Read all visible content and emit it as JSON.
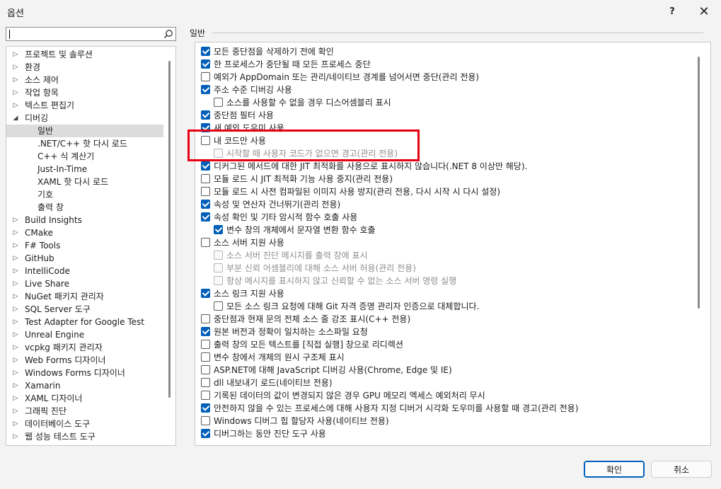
{
  "window": {
    "title": "옵션",
    "help_label": "?",
    "close_label": "✕"
  },
  "search": {
    "value": ""
  },
  "tree": [
    {
      "label": "프로젝트 및 솔루션",
      "indent": 0,
      "expander": "collapsed"
    },
    {
      "label": "환경",
      "indent": 0,
      "expander": "collapsed"
    },
    {
      "label": "소스 제어",
      "indent": 0,
      "expander": "collapsed"
    },
    {
      "label": "작업 항목",
      "indent": 0,
      "expander": "collapsed"
    },
    {
      "label": "텍스트 편집기",
      "indent": 0,
      "expander": "collapsed"
    },
    {
      "label": "디버깅",
      "indent": 0,
      "expander": "expanded"
    },
    {
      "label": "일반",
      "indent": 1,
      "expander": "none",
      "selected": true
    },
    {
      "label": ".NET/C++ 핫 다시 로드",
      "indent": 1,
      "expander": "none"
    },
    {
      "label": "C++ 식 계산기",
      "indent": 1,
      "expander": "none"
    },
    {
      "label": "Just-In-Time",
      "indent": 1,
      "expander": "none"
    },
    {
      "label": "XAML 핫 다시 로드",
      "indent": 1,
      "expander": "none"
    },
    {
      "label": "기호",
      "indent": 1,
      "expander": "none"
    },
    {
      "label": "출력 창",
      "indent": 1,
      "expander": "none"
    },
    {
      "label": "Build Insights",
      "indent": 0,
      "expander": "collapsed"
    },
    {
      "label": "CMake",
      "indent": 0,
      "expander": "collapsed"
    },
    {
      "label": "F# Tools",
      "indent": 0,
      "expander": "collapsed"
    },
    {
      "label": "GitHub",
      "indent": 0,
      "expander": "collapsed"
    },
    {
      "label": "IntelliCode",
      "indent": 0,
      "expander": "collapsed"
    },
    {
      "label": "Live Share",
      "indent": 0,
      "expander": "collapsed"
    },
    {
      "label": "NuGet 패키지 관리자",
      "indent": 0,
      "expander": "collapsed"
    },
    {
      "label": "SQL Server 도구",
      "indent": 0,
      "expander": "collapsed"
    },
    {
      "label": "Test Adapter for Google Test",
      "indent": 0,
      "expander": "collapsed"
    },
    {
      "label": "Unreal Engine",
      "indent": 0,
      "expander": "collapsed"
    },
    {
      "label": "vcpkg 패키지 관리자",
      "indent": 0,
      "expander": "collapsed"
    },
    {
      "label": "Web Forms 디자이너",
      "indent": 0,
      "expander": "collapsed"
    },
    {
      "label": "Windows Forms 디자이너",
      "indent": 0,
      "expander": "collapsed"
    },
    {
      "label": "Xamarin",
      "indent": 0,
      "expander": "collapsed"
    },
    {
      "label": "XAML 디자이너",
      "indent": 0,
      "expander": "collapsed"
    },
    {
      "label": "그래픽 진단",
      "indent": 0,
      "expander": "collapsed"
    },
    {
      "label": "데이터베이스 도구",
      "indent": 0,
      "expander": "collapsed"
    },
    {
      "label": "웹 성능 테스트 도구",
      "indent": 0,
      "expander": "collapsed"
    }
  ],
  "section_title": "일반",
  "options": [
    {
      "label": "모든 중단점을 삭제하기 전에 확인",
      "checked": true,
      "indent": 0,
      "disabled": false
    },
    {
      "label": "한 프로세스가 중단될 때 모든 프로세스 중단",
      "checked": true,
      "indent": 0,
      "disabled": false
    },
    {
      "label": "예외가 AppDomain 또는 관리/네이티브 경계를 넘어서면 중단(관리 전용)",
      "checked": false,
      "indent": 0,
      "disabled": false
    },
    {
      "label": "주소 수준 디버깅 사용",
      "checked": true,
      "indent": 0,
      "disabled": false
    },
    {
      "label": "소스를 사용할 수 없을 경우 디스어셈블리 표시",
      "checked": false,
      "indent": 1,
      "disabled": false
    },
    {
      "label": "중단점 필터 사용",
      "checked": true,
      "indent": 0,
      "disabled": false
    },
    {
      "label": "새 예외 도우미 사용",
      "checked": true,
      "indent": 0,
      "disabled": false
    },
    {
      "label": "내 코드만 사용",
      "checked": false,
      "indent": 0,
      "disabled": false
    },
    {
      "label": "시작할 때 사용자 코드가 없으면 경고(관리 전용)",
      "checked": false,
      "indent": 1,
      "disabled": true
    },
    {
      "label": "디커그된 메서드에 대한 JIT 최적화를 사용으로 표시하지 않습니다(.NET 8 이상만 해당).",
      "checked": true,
      "indent": 0,
      "disabled": false
    },
    {
      "label": "모듈 로드 시 JIT 최적화 기능 사용 중지(관리 전용)",
      "checked": false,
      "indent": 0,
      "disabled": false
    },
    {
      "label": "모듈 로드 시 사전 컴파일된 이미지 사용 방지(관리 전용, 다시 시작 시 다시 설정)",
      "checked": false,
      "indent": 0,
      "disabled": false
    },
    {
      "label": "속성 및 연산자 건너뛰기(관리 전용)",
      "checked": true,
      "indent": 0,
      "disabled": false
    },
    {
      "label": "속성 확인 및 기타 암시적 함수 호출 사용",
      "checked": true,
      "indent": 0,
      "disabled": false
    },
    {
      "label": "변수 창의 개체에서 문자열 변환 함수 호출",
      "checked": true,
      "indent": 1,
      "disabled": false
    },
    {
      "label": "소스 서버 지원 사용",
      "checked": false,
      "indent": 0,
      "disabled": false
    },
    {
      "label": "소스 서버 진단 메시지를 출력 창에 표시",
      "checked": false,
      "indent": 1,
      "disabled": true
    },
    {
      "label": "부분 신뢰 어셈블리에 대해 소스 서버 허용(관리 전용)",
      "checked": false,
      "indent": 1,
      "disabled": true
    },
    {
      "label": "항상 메시지를 표시하지 않고 신뢰할 수 없는 소스 서버 명령 실행",
      "checked": false,
      "indent": 1,
      "disabled": true
    },
    {
      "label": "소스 링크 지원 사용",
      "checked": true,
      "indent": 0,
      "disabled": false
    },
    {
      "label": "모든 소스 링크 요청에 대해 Git 자격 증명 관리자 인증으로 대체합니다.",
      "checked": false,
      "indent": 1,
      "disabled": false
    },
    {
      "label": "중단점과 현재 문의 전체 소스 줄 강조 표시(C++ 전용)",
      "checked": false,
      "indent": 0,
      "disabled": false
    },
    {
      "label": "원본 버전과 정확이 일치하는 소스파일 요청",
      "checked": true,
      "indent": 0,
      "disabled": false
    },
    {
      "label": "출력 창의 모든 텍스트를 [직접 실행] 창으로 리디렉션",
      "checked": false,
      "indent": 0,
      "disabled": false
    },
    {
      "label": "변수 창에서 개체의 원시 구조체 표시",
      "checked": false,
      "indent": 0,
      "disabled": false
    },
    {
      "label": "ASP.NET에 대해 JavaScript 디버깅 사용(Chrome, Edge 및 IE)",
      "checked": false,
      "indent": 0,
      "disabled": false
    },
    {
      "label": "dll 내보내기 로드(네이티브 전용)",
      "checked": false,
      "indent": 0,
      "disabled": false
    },
    {
      "label": "기록된 데이터의 값이 변경되지 않은 경우 GPU 메모리 엑세스 예외처리 무시",
      "checked": false,
      "indent": 0,
      "disabled": false
    },
    {
      "label": "안전하지 않을 수 있는 프로세스에 대해 사용자 지정 디버거 시각화 도우미를 사용할 때 경고(관리 전용)",
      "checked": true,
      "indent": 0,
      "disabled": false
    },
    {
      "label": "Windows 디버그 힙 할당자 사용(네이티브 전용)",
      "checked": false,
      "indent": 0,
      "disabled": false
    },
    {
      "label": "디버그하는 동안 진단 도구 사용",
      "checked": true,
      "indent": 0,
      "disabled": false
    }
  ],
  "buttons": {
    "ok": "확인",
    "cancel": "취소"
  },
  "colors": {
    "accent": "#005fb8",
    "highlight_box": "#e60012"
  }
}
